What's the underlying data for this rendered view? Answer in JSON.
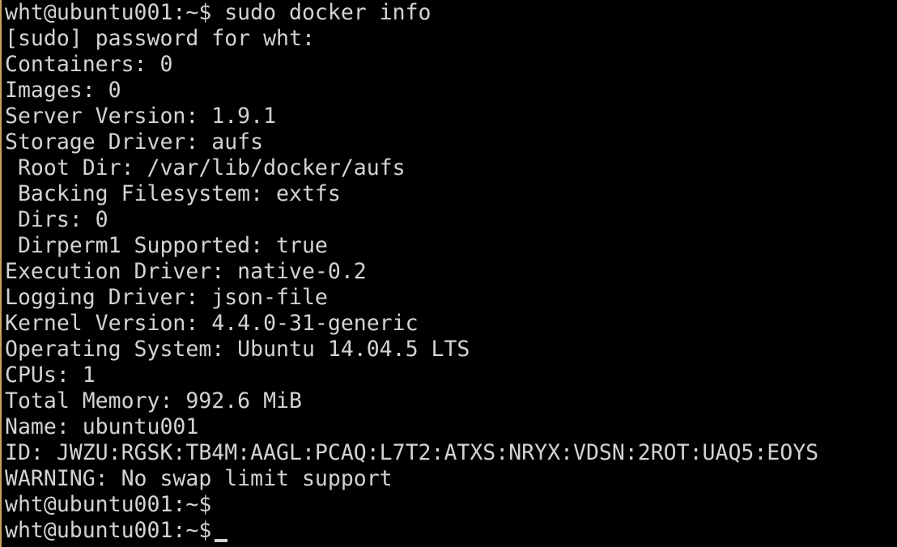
{
  "terminal": {
    "lines": [
      "wht@ubuntu001:~$ sudo docker info",
      "[sudo] password for wht:",
      "Containers: 0",
      "Images: 0",
      "Server Version: 1.9.1",
      "Storage Driver: aufs",
      " Root Dir: /var/lib/docker/aufs",
      " Backing Filesystem: extfs",
      " Dirs: 0",
      " Dirperm1 Supported: true",
      "Execution Driver: native-0.2",
      "Logging Driver: json-file",
      "Kernel Version: 4.4.0-31-generic",
      "Operating System: Ubuntu 14.04.5 LTS",
      "CPUs: 1",
      "Total Memory: 992.6 MiB",
      "Name: ubuntu001",
      "ID: JWZU:RGSK:TB4M:AAGL:PCAQ:L7T2:ATXS:NRYX:VDSN:2ROT:UAQ5:EOYS",
      "WARNING: No swap limit support",
      "wht@ubuntu001:~$",
      "wht@ubuntu001:~$"
    ]
  }
}
